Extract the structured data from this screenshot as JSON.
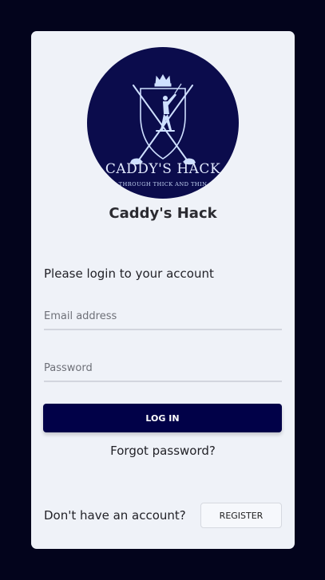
{
  "logo": {
    "title": "CADDY'S HACK",
    "tagline": "THROUGH THICK AND THIN",
    "icons": [
      "crown-icon",
      "shield-icon",
      "golfer-icon",
      "golf-club-icon"
    ]
  },
  "app_name": "Caddy's Hack",
  "login": {
    "prompt": "Please login to your account",
    "email_placeholder": "Email address",
    "password_placeholder": "Password",
    "submit_label": "LOG IN",
    "forgot_label": "Forgot password?"
  },
  "register": {
    "prompt": "Don't have an account?",
    "button_label": "REGISTER"
  },
  "colors": {
    "page_background": "#03041c",
    "card_background": "#eff2f8",
    "primary": "#010148",
    "logo_background": "#0b0c4c"
  }
}
